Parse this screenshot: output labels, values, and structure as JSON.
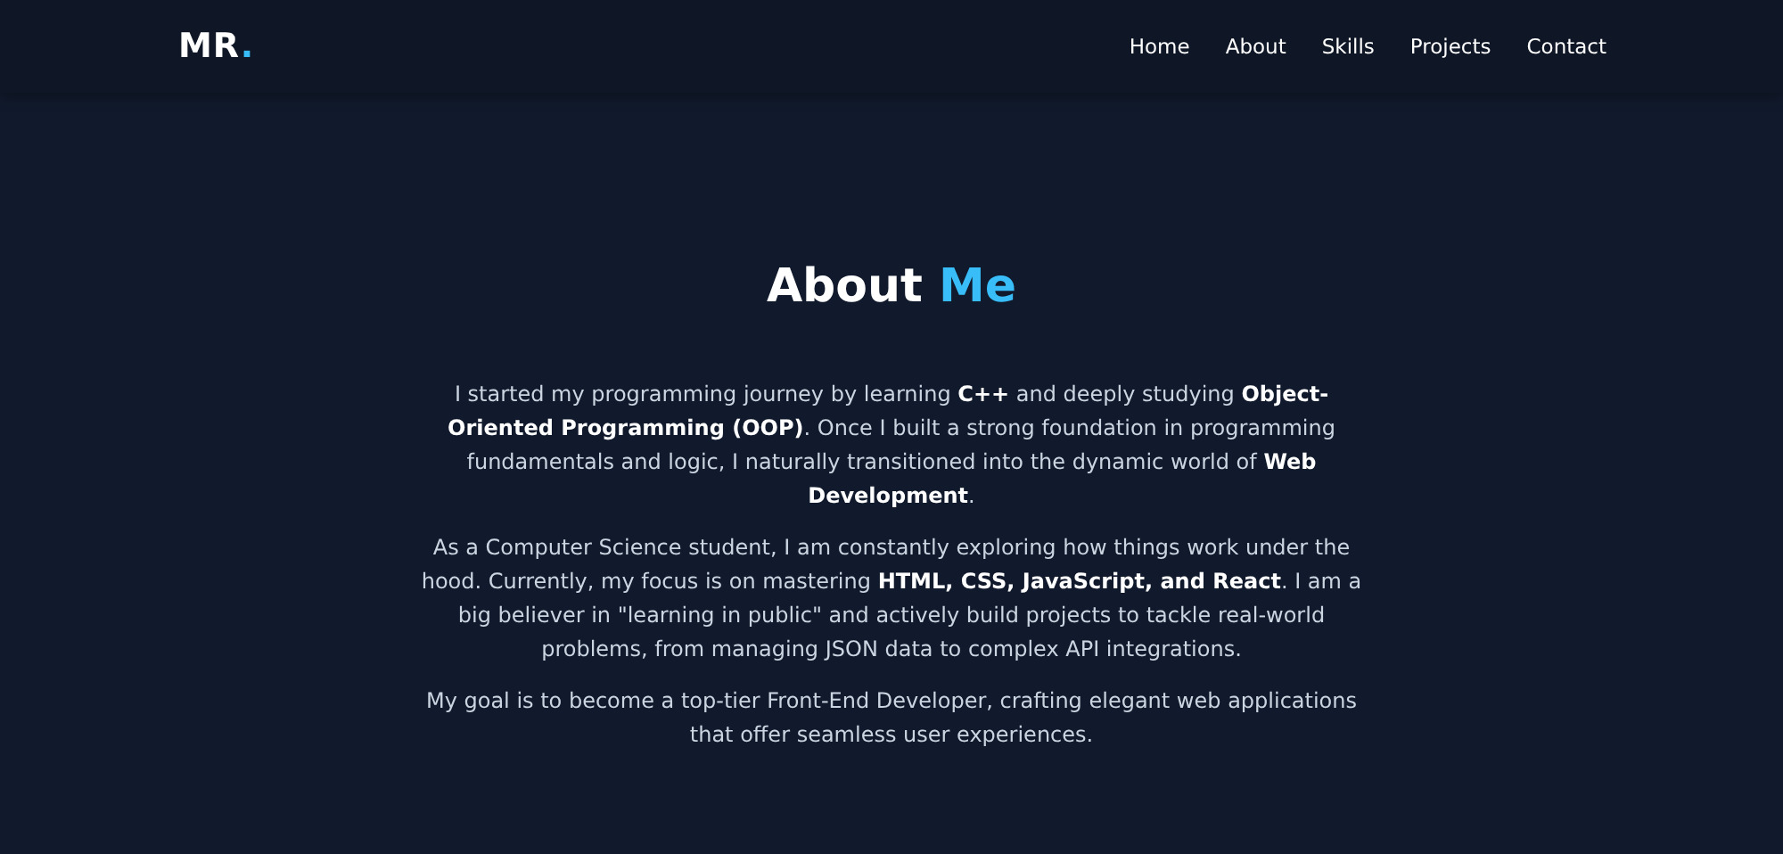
{
  "header": {
    "logo": {
      "text": "MR",
      "accent": "."
    },
    "nav": [
      {
        "label": "Home"
      },
      {
        "label": "About"
      },
      {
        "label": "Skills"
      },
      {
        "label": "Projects"
      },
      {
        "label": "Contact"
      }
    ]
  },
  "about": {
    "heading": {
      "text": "About",
      "accent": "Me"
    },
    "paragraphs": [
      "I started my programming journey by learning **C++** and deeply studying **Object-Oriented Programming (OOP)**. Once I built a strong foundation in programming fundamentals and logic, I naturally transitioned into the dynamic world of **Web Development**.",
      "As a Computer Science student, I am constantly exploring how things work under the hood. Currently, my focus is on mastering **HTML, CSS, JavaScript, and React**. I am a big believer in \"learning in public\" and actively build projects to tackle real-world problems, from managing JSON data to complex API integrations.",
      "My goal is to become a top-tier Front-End Developer, crafting elegant web applications that offer seamless user experiences."
    ]
  }
}
